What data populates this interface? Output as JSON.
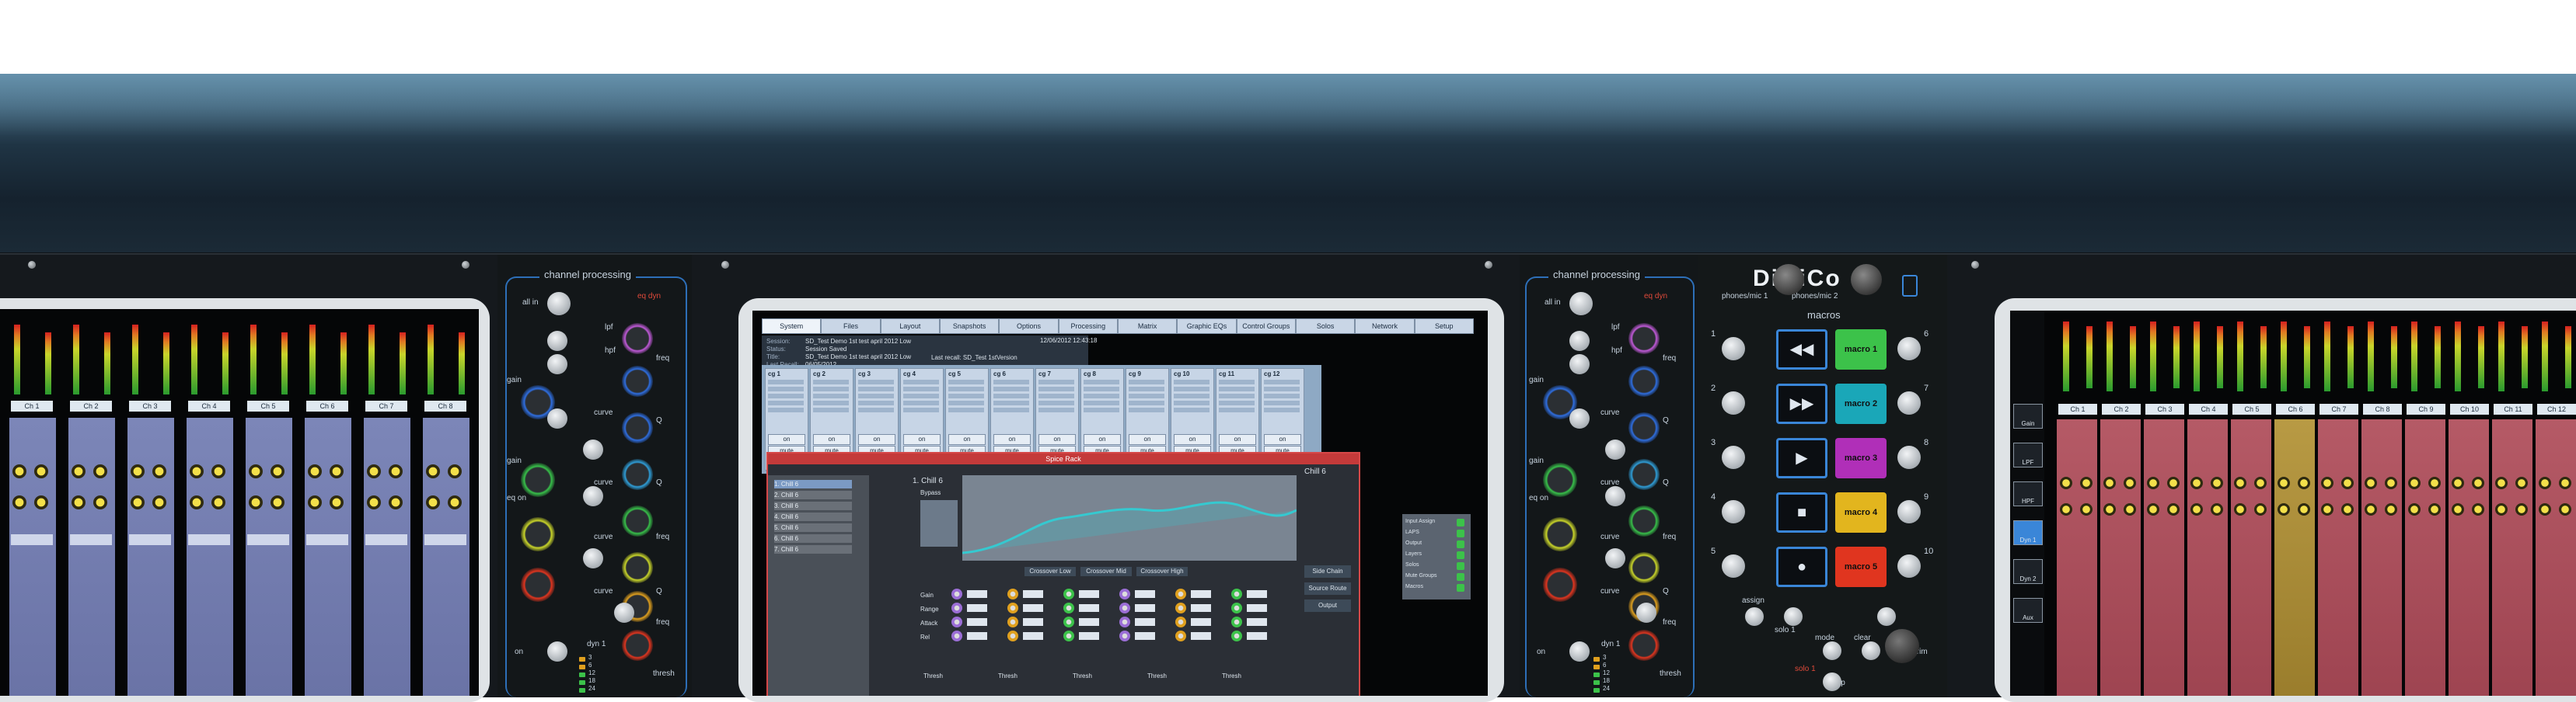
{
  "brand": "DiGiCo",
  "channel_processing": {
    "title": "channel processing",
    "labels": {
      "all_in": "all in",
      "eq_dyn": "eq dyn",
      "lpf": "lpf",
      "hpf": "hpf",
      "gain": "gain",
      "freq": "freq",
      "curve": "curve",
      "q": "Q",
      "eq_on": "eq on",
      "on": "on",
      "dyn1": "dyn 1",
      "thresh": "thresh"
    },
    "meter_scale": [
      "3",
      "6",
      "12",
      "18",
      "24"
    ]
  },
  "main_screen": {
    "tabs": [
      "System",
      "Files",
      "Layout",
      "Snapshots",
      "Options",
      "Processing",
      "Matrix",
      "Graphic EQs",
      "Control Groups",
      "Solos",
      "Network",
      "Setup"
    ],
    "status_rows": [
      {
        "label": "Session:",
        "value": "SD_Test Demo 1st test april 2012 Low"
      },
      {
        "label": "Status:",
        "value": "Session Saved"
      },
      {
        "label": "Title:",
        "value": "SD_Test Demo 1st test april 2012 Low"
      },
      {
        "label": "Last Recall:",
        "value": "06/05/2012"
      }
    ],
    "timestamp": "12/06/2012 12:43:18",
    "last_recall_right": "Last recall: SD_Test 1stVersion",
    "group_columns": [
      "cg 1",
      "cg 2",
      "cg 3",
      "cg 4",
      "cg 5",
      "cg 6",
      "cg 7",
      "cg 8",
      "cg 9",
      "cg 10",
      "cg 11",
      "cg 12"
    ],
    "group_footer": [
      "on",
      "mute",
      "fader"
    ],
    "eq_window": {
      "title": "Spice Rack",
      "header_right": "Chill 6",
      "channel_list": [
        "1. Chill 6",
        "2. Chill 6",
        "3. Chill 6",
        "4. Chill 6",
        "5. Chill 6",
        "6. Chill 6",
        "7. Chill 6"
      ],
      "channel_title": "1. Chill 6",
      "bypass_label": "Bypass",
      "side_buttons": [
        "Side Chain",
        "Source Route",
        "Output"
      ],
      "band_headers": [
        "Crossover Low",
        "Crossover Mid",
        "Crossover High"
      ],
      "row_labels": [
        "Gain",
        "Range",
        "Attack",
        "Rel"
      ],
      "bottom_labels": [
        "Thresh",
        "Thresh",
        "Thresh",
        "Thresh",
        "Thresh"
      ]
    },
    "side_panel_items": [
      "Input Assign",
      "LAPS",
      "Output",
      "Layers",
      "Solos",
      "Mute Groups",
      "Macros"
    ]
  },
  "macros_panel": {
    "title": "macros",
    "headers": [
      "phones/mic 1",
      "phones/mic 2"
    ],
    "macro_buttons": [
      {
        "label": "macro 1",
        "color": "#3cc24a"
      },
      {
        "label": "macro 2",
        "color": "#1aa7b8"
      },
      {
        "label": "macro 3",
        "color": "#b02fb8"
      },
      {
        "label": "macro 4",
        "color": "#e2b51e"
      },
      {
        "label": "macro 5",
        "color": "#e0351f"
      }
    ],
    "transport_icons": [
      "rewind-icon",
      "fast-forward-icon",
      "play-icon",
      "stop-icon",
      "record-icon"
    ],
    "numbers_left": [
      "1",
      "2",
      "3",
      "4",
      "5"
    ],
    "numbers_right": [
      "6",
      "7",
      "8",
      "9",
      "10"
    ],
    "assign": "assign",
    "solo_1": "solo 1",
    "mode": "mode",
    "clear": "clear",
    "trim": "trim",
    "solo_label": "solo 1",
    "sip": "sip"
  },
  "right_bay": {
    "left_buttons": [
      "Gain",
      "LPF",
      "HPF",
      "Dyn 1",
      "Dyn 2",
      "Aux"
    ],
    "channel_names": [
      "Ch 1",
      "Ch 2",
      "Ch 3",
      "Ch 4",
      "Ch 5",
      "Ch 6",
      "Ch 7",
      "Ch 8",
      "Ch 9",
      "Ch 10",
      "Ch 11",
      "Ch 12"
    ]
  },
  "left_bay": {
    "channel_names": [
      "Ch 1",
      "Ch 2",
      "Ch 3",
      "Ch 4",
      "Ch 5",
      "Ch 6",
      "Ch 7",
      "Ch 8"
    ]
  }
}
